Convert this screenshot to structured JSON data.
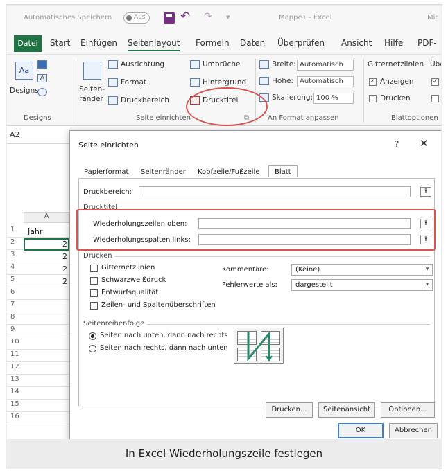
{
  "titlebar": {
    "autosave": "Automatisches Speichern",
    "toggle": "Aus",
    "undo": "↶",
    "redo": "↷",
    "doc_title": "Mappe1 - Excel",
    "user": "Mic"
  },
  "tabs": [
    "Datei",
    "Start",
    "Einfügen",
    "Seitenlayout",
    "Formeln",
    "Daten",
    "Überprüfen",
    "Ansicht",
    "Hilfe",
    "PDF-"
  ],
  "ribbon": {
    "designs": {
      "label": "Designs",
      "group": "Designs",
      "icon_text": "Aa",
      "font_icon": "A"
    },
    "page_setup": {
      "ausrichtung": "Ausrichtung",
      "format": "Format",
      "druckbereich": "Druckbereich",
      "umbrueche": "Umbrüche",
      "hintergrund": "Hintergrund",
      "drucktitel": "Drucktitel",
      "seitenraender_1": "Seiten-",
      "seitenraender_2": "ränder",
      "group": "Seite einrichten"
    },
    "scale": {
      "breite_label": "Breite:",
      "breite_value": "Automatisch",
      "hoehe_label": "Höhe:",
      "hoehe_value": "Automatisch",
      "skalierung_label": "Skalierung:",
      "skalierung_value": "100 %",
      "group": "An Format anpassen"
    },
    "sheet_options": {
      "gitternetzlinien": "Gitternetzlinien",
      "ueberschriften": "Übe",
      "anzeigen": "Anzeigen",
      "drucken": "Drucken",
      "group": "Blattoptionen"
    }
  },
  "formula_bar": {
    "name_box": "A2"
  },
  "sheet": {
    "column_a": "A",
    "rows": [
      "1",
      "2",
      "3",
      "4",
      "5",
      "6",
      "7",
      "8",
      "9",
      "10",
      "11",
      "12",
      "13",
      "14",
      "15",
      "16"
    ],
    "cell_a1": "Jahr",
    "cells_col_a_partial": [
      "2",
      "2",
      "2",
      "2"
    ]
  },
  "dialog": {
    "title": "Seite einrichten",
    "help": "?",
    "close": "✕",
    "tabs": [
      "Papierformat",
      "Seitenränder",
      "Kopfzeile/Fußzeile",
      "Blatt"
    ],
    "active_tab": "Blatt",
    "druckbereich_label": "Druckbereich:",
    "drucktitel_heading": "Drucktitel",
    "wdh_zeilen_label": "Wiederholungszeilen oben:",
    "wdh_spalten_label": "Wiederholungsspalten links:",
    "drucken_heading": "Drucken",
    "checkboxes": [
      "Gitternetzlinien",
      "Schwarzweißdruck",
      "Entwurfsqualität",
      "Zeilen- und Spaltenüberschriften"
    ],
    "kommentare_label": "Kommentare:",
    "kommentare_value": "(Keine)",
    "fehlerwerte_label": "Fehlerwerte als:",
    "fehlerwerte_value": "dargestellt",
    "reihenfolge_heading": "Seitenreihenfolge",
    "radio_down_then_right": "Seiten nach unten, dann nach rechts",
    "radio_right_then_down": "Seiten nach rechts, dann nach unten",
    "btn_drucken": "Drucken...",
    "btn_seitenansicht": "Seitenansicht",
    "btn_optionen": "Optionen...",
    "btn_ok": "OK",
    "btn_abbrechen": "Abbrechen",
    "collapse_glyph": "⭱"
  },
  "caption": "In Excel Wiederholungszeile festlegen",
  "colors": {
    "excel_green": "#217346",
    "highlight_red": "#d9534f"
  }
}
